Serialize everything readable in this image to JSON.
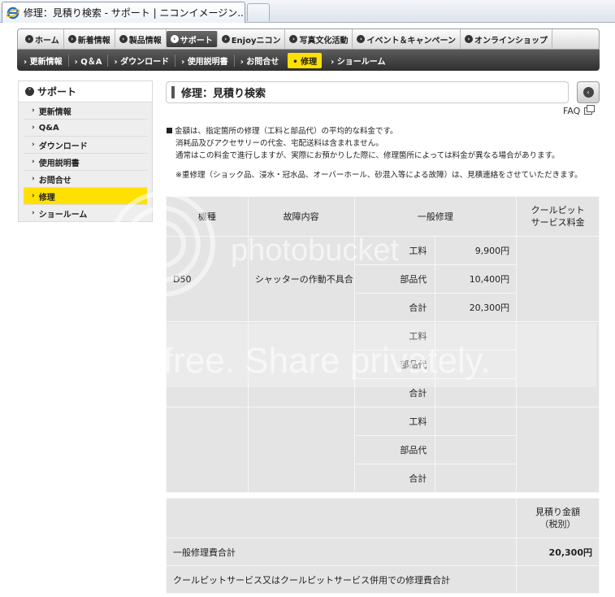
{
  "browser": {
    "tab_title": "修理：見積り検索 - サポート | ニコンイメージン..."
  },
  "global_nav": {
    "items": [
      "ホーム",
      "新着情報",
      "製品情報",
      "サポート",
      "Enjoyニコン",
      "写真文化活動",
      "イベント＆キャンペーン",
      "オンラインショップ"
    ],
    "active_index": 3
  },
  "sub_nav": {
    "items": [
      "更新情報",
      "Q＆A",
      "ダウンロード",
      "使用説明書",
      "お問合せ",
      "修理",
      "ショールーム"
    ],
    "active_index": 5
  },
  "sidebar": {
    "title": "サポート",
    "items": [
      "更新情報",
      "Q&A",
      "ダウンロード",
      "使用説明書",
      "お問合せ",
      "修理",
      "ショールーム"
    ],
    "active_index": 5
  },
  "content": {
    "title": "修理：見積り検索",
    "faq_label": "FAQ"
  },
  "notes": {
    "line1": "金額は、指定箇所の修理（工料と部品代）の平均的な料金です。",
    "line2": "消耗品及びアクセサリーの代金、宅配送料は含まれません。",
    "line3": "通常はこの料金で進行しますが、実際にお預かりした際に、修理箇所によっては料金が異なる場合があります。",
    "line4": "※重修理（ショック品、浸水・冠水品、オーバーホール、砂混入等による故障）は、見積連絡をさせていただきます。"
  },
  "estimate_table": {
    "headers": {
      "model": "機種",
      "fault": "故障内容",
      "general": "一般修理",
      "coolpit_line1": "クールピット",
      "coolpit_line2": "サービス料金"
    },
    "sub_labels": {
      "labor": "工料",
      "parts": "部品代",
      "total": "合計"
    },
    "rows": [
      {
        "model": "D50",
        "fault": "シャッターの作動不具合",
        "labor": "9,900円",
        "parts": "10,400円",
        "total": "20,300円"
      },
      {
        "model": "",
        "fault": "",
        "labor": "",
        "parts": "",
        "total": ""
      },
      {
        "model": "",
        "fault": "",
        "labor": "",
        "parts": "",
        "total": ""
      }
    ]
  },
  "total_table": {
    "header_line1": "見積り金額",
    "header_line2": "（税別）",
    "general_label": "一般修理費合計",
    "general_value": "20,300円",
    "coolpit_label": "クールピットサービス又はクールピットサービス併用での修理費合計",
    "coolpit_value": ""
  },
  "watermark": {
    "brand": "photobucket",
    "slogan": "Join free. Share privately."
  },
  "colors": {
    "accent_yellow": "#ffe000",
    "nav_dark": "#3b3b3b",
    "table_gray": "#e4e4e4"
  }
}
